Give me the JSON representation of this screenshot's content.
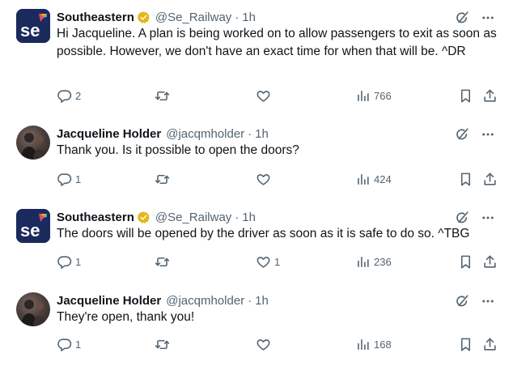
{
  "tweets": [
    {
      "name": "Southeastern",
      "handle": "@Se_Railway",
      "separator": "·",
      "time": "1h",
      "avatar_text": "se",
      "text": "Hi Jacqueline. A plan is being worked on to allow passengers to exit as soon as possible. However, we don't have an exact time for when that will be. ^DR",
      "replies": "2",
      "retweets": "",
      "likes": "",
      "views": "766"
    },
    {
      "name": "Jacqueline Holder",
      "handle": "@jacqmholder",
      "separator": "·",
      "time": "1h",
      "text": "Thank you. Is it possible to open the doors?",
      "replies": "1",
      "retweets": "",
      "likes": "",
      "views": "424"
    },
    {
      "name": "Southeastern",
      "handle": "@Se_Railway",
      "separator": "·",
      "time": "1h",
      "avatar_text": "se",
      "text": "The doors will be opened by the driver as soon as it is safe to do so. ^TBG",
      "replies": "1",
      "retweets": "",
      "likes": "1",
      "views": "236"
    },
    {
      "name": "Jacqueline Holder",
      "handle": "@jacqmholder",
      "separator": "·",
      "time": "1h",
      "text": "They're open, thank you!",
      "replies": "1",
      "retweets": "",
      "likes": "",
      "views": "168"
    }
  ],
  "colors": {
    "text_primary": "#0f1419",
    "text_secondary": "#536471",
    "verified_gold": "#e2b719",
    "brand_navy": "#1b2a5c"
  },
  "icons": [
    "verified-badge-icon",
    "grok-icon",
    "more-icon",
    "reply-icon",
    "retweet-icon",
    "like-icon",
    "views-icon",
    "bookmark-icon",
    "share-icon"
  ]
}
